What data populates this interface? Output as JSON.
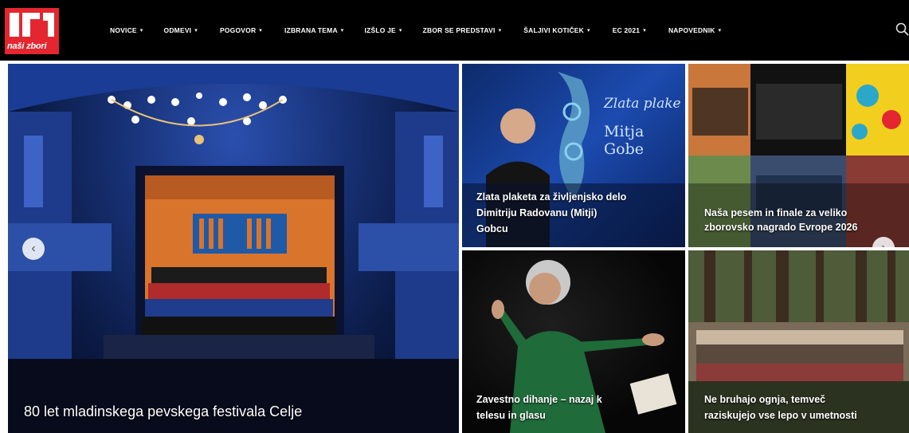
{
  "brand": {
    "logo_text": "naši zbori",
    "accent_color": "#e3262f"
  },
  "nav": {
    "items": [
      {
        "label": "NOVICE"
      },
      {
        "label": "ODMEVI"
      },
      {
        "label": "POGOVOR"
      },
      {
        "label": "IZBRANA TEMA"
      },
      {
        "label": "IZŠLO JE"
      },
      {
        "label": "ZBOR SE PREDSTAVI"
      },
      {
        "label": "ŠALJIVI KOTIČEK"
      },
      {
        "label": "EC 2021"
      },
      {
        "label": "NAPOVEDNIK"
      }
    ],
    "caret": "▾",
    "search_icon": "search-icon"
  },
  "slider": {
    "prev_glyph": "‹",
    "next_glyph": "›"
  },
  "featured": {
    "hero": {
      "title": "80 let mladinskega pevskega festivala Celje"
    },
    "tile1": {
      "line1": "Zlata plaketa za življenjsko delo",
      "line2": "Dimitriju Radovanu (Mitji)",
      "line3": "Gobcu",
      "banner_line1": "Zlata plake",
      "banner_line2": "Mitja Gobe"
    },
    "tile2": {
      "line1": "Naša pesem in finale za veliko",
      "line2": "zborovsko nagrado Evrope 2026"
    },
    "tile3": {
      "line1": "Zavestno dihanje – nazaj k",
      "line2": "telesu in glasu"
    },
    "tile4": {
      "line1": "Ne bruhajo ognja, temveč",
      "line2": "raziskujejo vse lepo v umetnosti"
    }
  }
}
